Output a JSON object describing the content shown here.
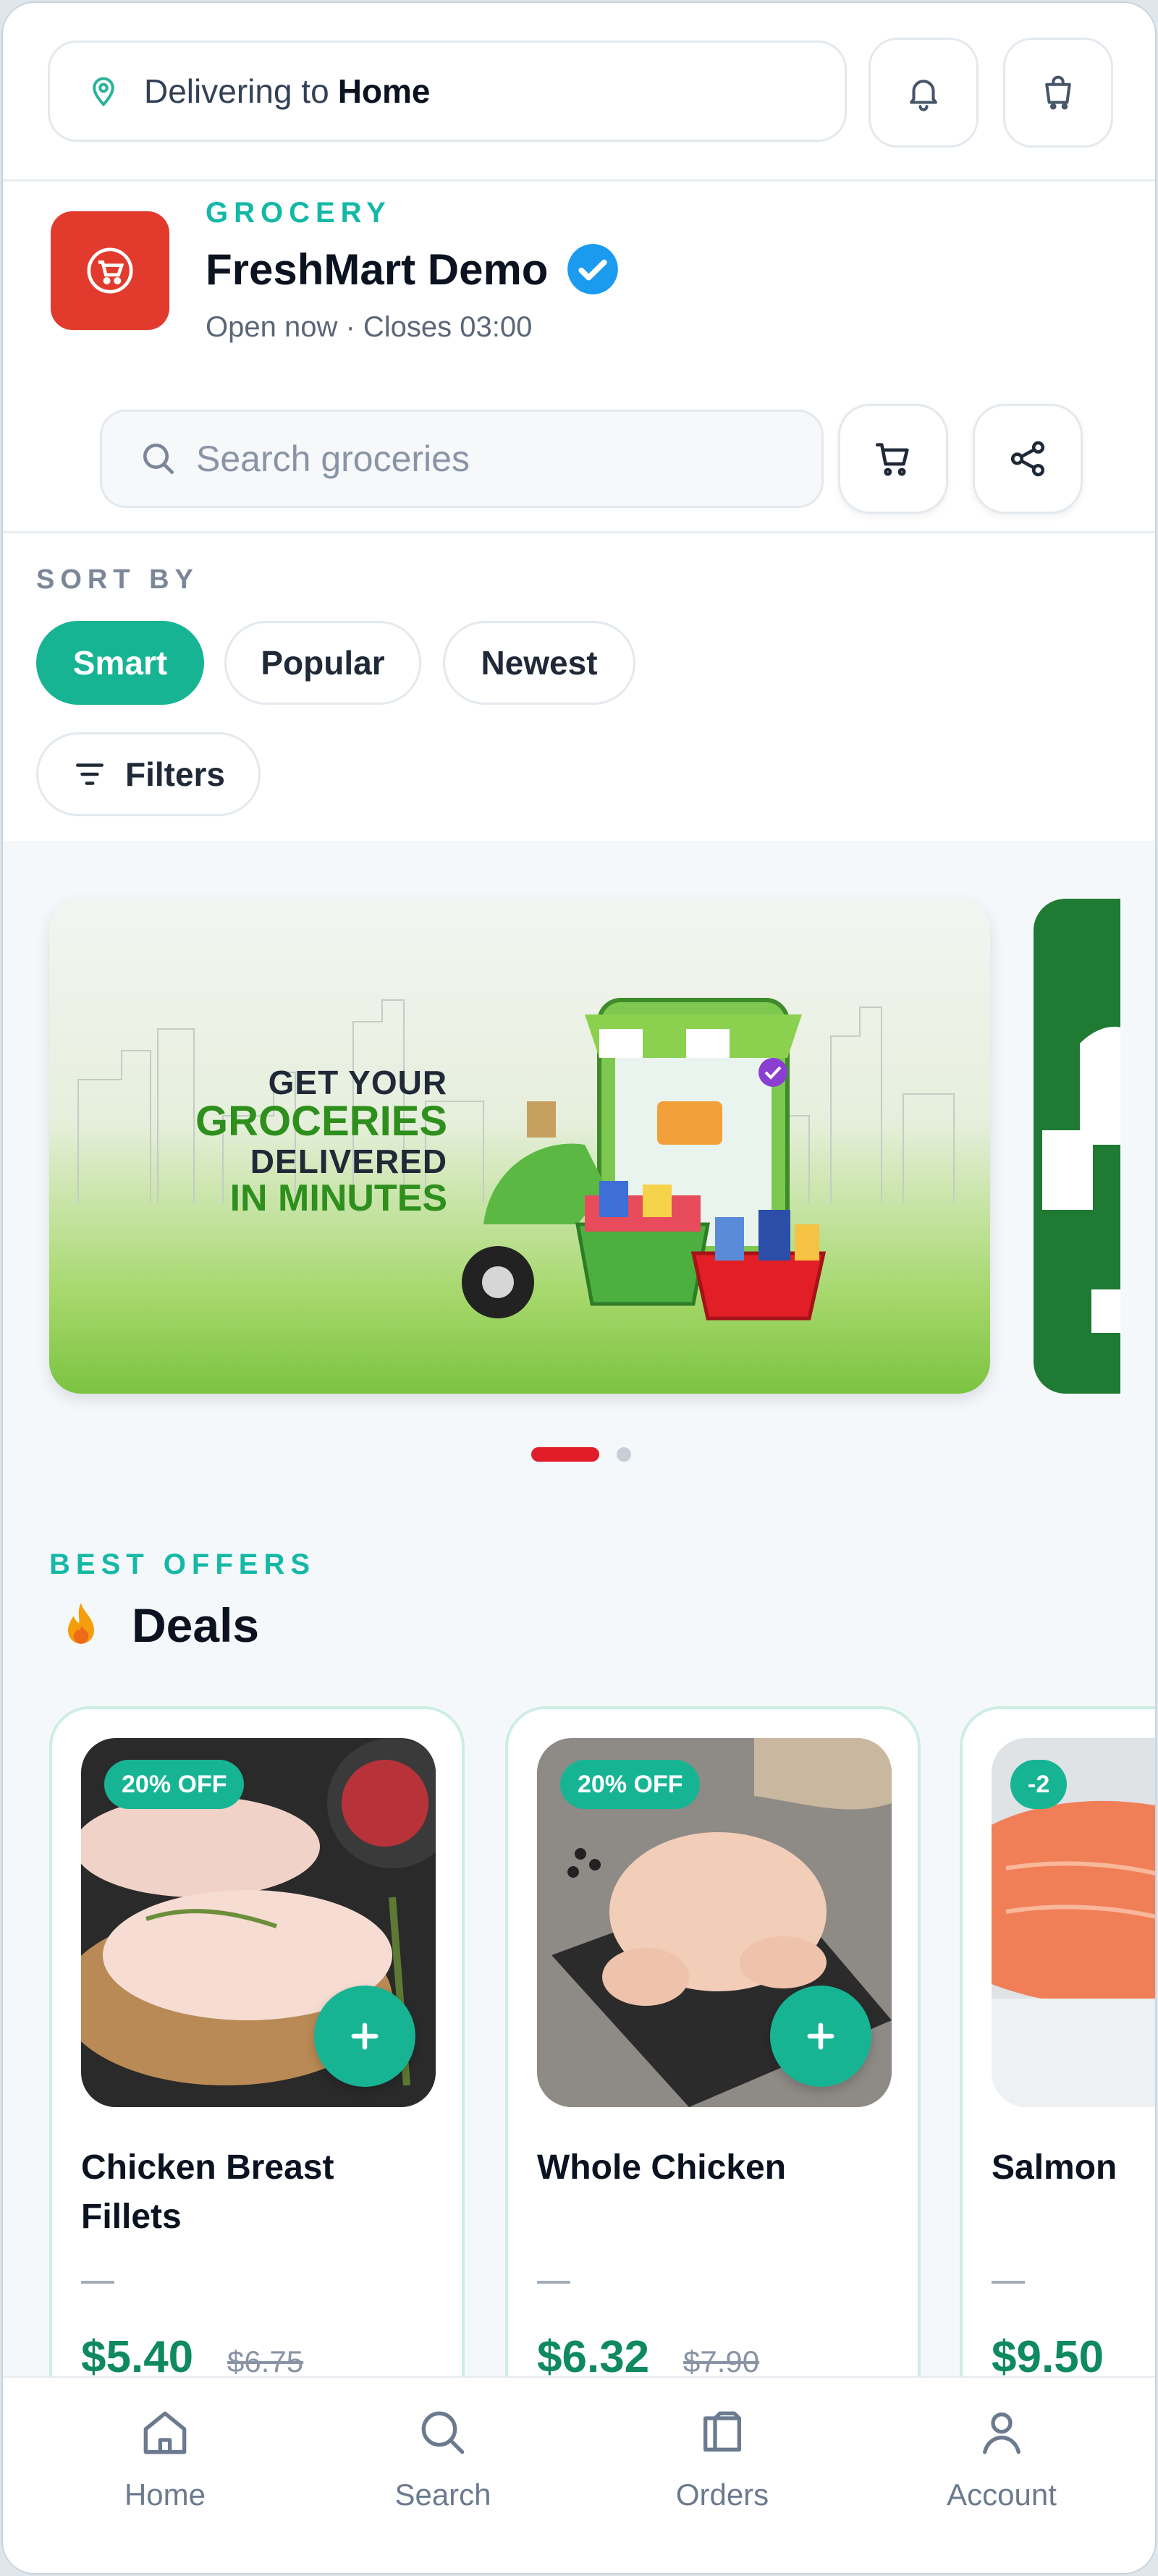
{
  "header": {
    "delivering_prefix": "Delivering to",
    "delivering_location": "Home",
    "icons": [
      "location-pin-icon",
      "bell-icon",
      "cart-icon"
    ]
  },
  "store": {
    "category": "GROCERY",
    "name": "FreshMart Demo",
    "status": "Open now · Closes 03:00",
    "search_placeholder": "Search groceries",
    "brand_color": "#e23b2e"
  },
  "sort": {
    "label": "SORT BY",
    "options": [
      "Smart",
      "Popular",
      "Newest"
    ],
    "selected": "Smart",
    "filters_label": "Filters"
  },
  "banner": {
    "line1": "GET YOUR",
    "line2": "GROCERIES",
    "line3": "DELIVERED",
    "line4": "IN MINUTES",
    "slides_total": 2,
    "active_slide": 1
  },
  "deals": {
    "kicker": "BEST OFFERS",
    "title": "Deals",
    "items": [
      {
        "badge": "20% OFF",
        "name": "Chicken Breast Fillets",
        "price": "$5.40",
        "old_price": "$6.75"
      },
      {
        "badge": "20% OFF",
        "name": "Whole Chicken",
        "price": "$6.32",
        "old_price": "$7.90"
      },
      {
        "badge": "-2",
        "name": "Salmon",
        "price": "$9.50",
        "old_price": ""
      }
    ]
  },
  "bottom_nav": {
    "items": [
      {
        "label": "Home",
        "icon": "home-icon"
      },
      {
        "label": "Search",
        "icon": "search-icon"
      },
      {
        "label": "Orders",
        "icon": "orders-icon"
      },
      {
        "label": "Account",
        "icon": "account-icon"
      }
    ]
  },
  "colors": {
    "accent": "#17b494",
    "price": "#0f8a5f",
    "dot_active": "#e11d2a"
  }
}
